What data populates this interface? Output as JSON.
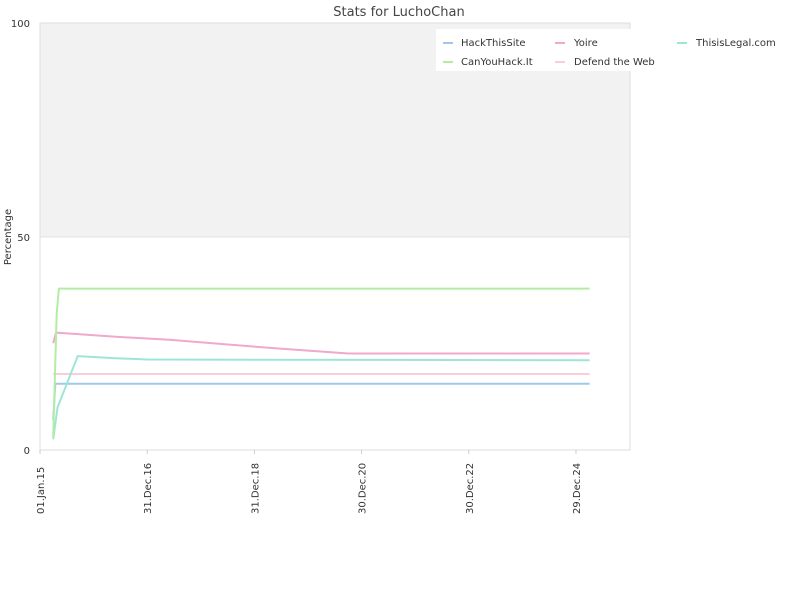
{
  "chart_data": {
    "type": "line",
    "title": "Stats for LuchoChan",
    "xlabel": "",
    "ylabel": "Percentage",
    "ylim": [
      0,
      100
    ],
    "xlim": [
      "2015-01-01",
      "2026-01-01"
    ],
    "y_ticks": [
      "0",
      "50",
      "100"
    ],
    "x_ticks": [
      {
        "label": "01.Jan.15",
        "date": "2015-01-01"
      },
      {
        "label": "31.Dec.16",
        "date": "2016-12-31"
      },
      {
        "label": "31.Dec.18",
        "date": "2018-12-31"
      },
      {
        "label": "30.Dec.20",
        "date": "2020-12-30"
      },
      {
        "label": "30.Dec.22",
        "date": "2022-12-30"
      },
      {
        "label": "29.Dec.24",
        "date": "2024-12-29"
      }
    ],
    "grid": false,
    "legend_position": "top-right",
    "series": [
      {
        "name": "HackThisSite",
        "color": "#9fc8ec",
        "points": [
          [
            "2015-04-01",
            7
          ],
          [
            "2015-04-15",
            15.5
          ],
          [
            "2025-04-01",
            15.5
          ]
        ]
      },
      {
        "name": "Yoire",
        "color": "#f0a8cc",
        "points": [
          [
            "2015-04-01",
            25
          ],
          [
            "2015-04-20",
            27.5
          ],
          [
            "2016-06-01",
            26.5
          ],
          [
            "2017-06-01",
            25.8
          ],
          [
            "2018-06-01",
            24.8
          ],
          [
            "2019-06-01",
            23.8
          ],
          [
            "2020-10-01",
            22.6
          ],
          [
            "2025-04-01",
            22.6
          ]
        ]
      },
      {
        "name": "ThisisLegal.com",
        "color": "#9de6d6",
        "points": [
          [
            "2015-04-01",
            2.5
          ],
          [
            "2015-05-01",
            10
          ],
          [
            "2015-09-15",
            22
          ],
          [
            "2016-06-01",
            21.5
          ],
          [
            "2017-01-01",
            21.2
          ],
          [
            "2025-04-01",
            21
          ]
        ]
      },
      {
        "name": "CanYouHack.It",
        "color": "#b4eca4",
        "points": [
          [
            "2015-04-01",
            3
          ],
          [
            "2015-04-25",
            32
          ],
          [
            "2015-05-10",
            37.8
          ],
          [
            "2025-04-01",
            37.8
          ]
        ]
      },
      {
        "name": "Defend the Web",
        "color": "#f8cfd9",
        "points": [
          [
            "2015-04-01",
            17.8
          ],
          [
            "2025-04-01",
            17.8
          ]
        ]
      }
    ]
  }
}
